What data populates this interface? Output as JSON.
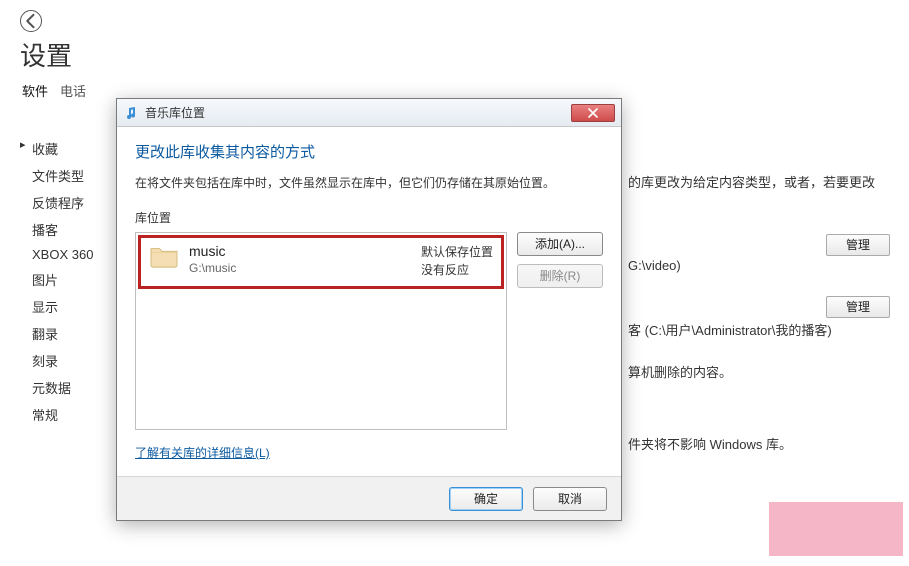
{
  "page": {
    "title": "设置",
    "tabs": [
      "软件",
      "电话"
    ],
    "activeTabIndex": 0
  },
  "sidebar": {
    "items": [
      "收藏",
      "文件类型",
      "反馈程序",
      "播客",
      "XBOX 360",
      "图片",
      "显示",
      "翻录",
      "刻录",
      "元数据",
      "常规"
    ],
    "activeIndex": 0
  },
  "background": {
    "line1": "的库更改为给定内容类型，或者，若要更改",
    "path1": "G:\\video)",
    "path2": "客 (C:\\用户\\Administrator\\我的播客)",
    "line_del": "算机删除的内容。",
    "line_lib": "件夹将不影响 Windows 库。",
    "manage_btn": "管理"
  },
  "dialog": {
    "title": "音乐库位置",
    "heading": "更改此库收集其内容的方式",
    "description": "在将文件夹包括在库中时，文件虽然显示在库中，但它们仍存储在其原始位置。",
    "section_label": "库位置",
    "item": {
      "name": "music",
      "path": "G:\\music",
      "status1": "默认保存位置",
      "status2": "没有反应"
    },
    "add_btn": "添加(A)...",
    "remove_btn": "删除(R)",
    "more_link": "了解有关库的详细信息(L)",
    "ok_btn": "确定",
    "cancel_btn": "取消"
  }
}
